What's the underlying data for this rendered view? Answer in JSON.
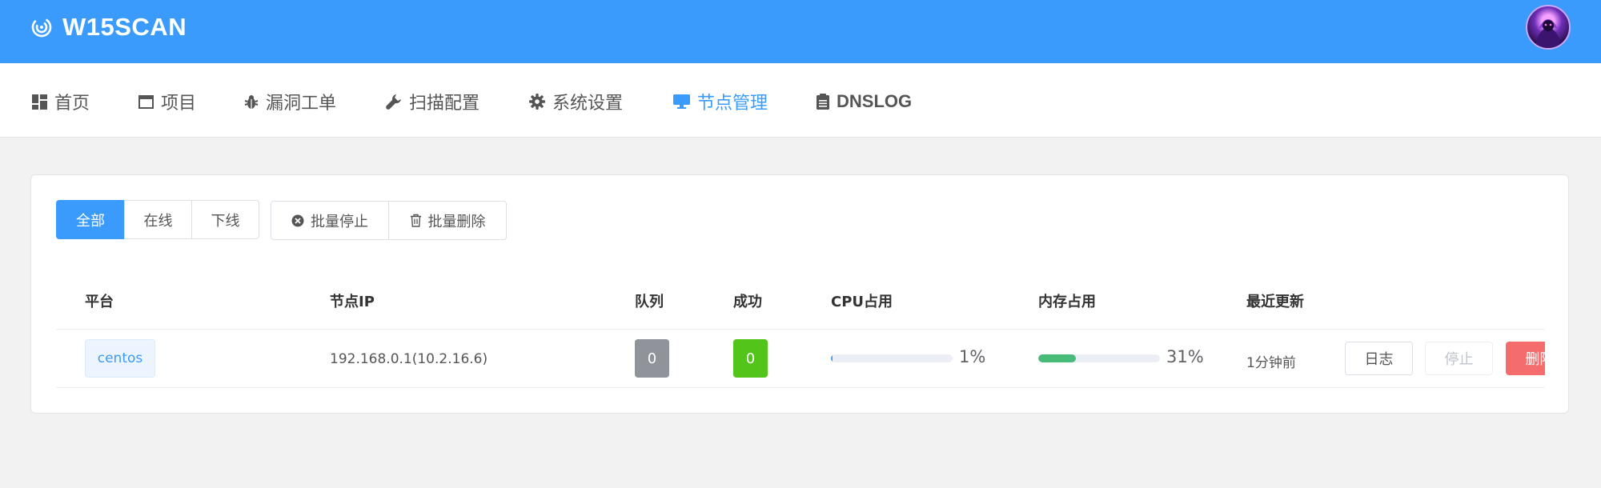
{
  "app": {
    "title": "W15SCAN"
  },
  "nav": [
    {
      "label": "首页",
      "icon": "dashboard-icon",
      "active": false
    },
    {
      "label": "项目",
      "icon": "window-icon",
      "active": false
    },
    {
      "label": "漏洞工单",
      "icon": "bug-icon",
      "active": false
    },
    {
      "label": "扫描配置",
      "icon": "wrench-icon",
      "active": false
    },
    {
      "label": "系统设置",
      "icon": "gear-icon",
      "active": false
    },
    {
      "label": "节点管理",
      "icon": "monitor-icon",
      "active": true
    },
    {
      "label": "DNSLOG",
      "icon": "clipboard-icon",
      "active": false
    }
  ],
  "filter_tabs": {
    "all": "全部",
    "online": "在线",
    "offline": "下线",
    "selected": "全部"
  },
  "actions": {
    "batch_stop": "批量停止",
    "batch_delete": "批量删除"
  },
  "table": {
    "headers": {
      "platform": "平台",
      "ip": "节点IP",
      "queue": "队列",
      "success": "成功",
      "cpu": "CPU占用",
      "mem": "内存占用",
      "updated": "最近更新"
    },
    "rows": [
      {
        "platform": "centos",
        "ip": "192.168.0.1(10.2.16.6)",
        "queue": "0",
        "success": "0",
        "cpu_label": "1%",
        "cpu_value": 1,
        "mem_label": "31%",
        "mem_value": 31,
        "updated": "1分钟前",
        "ops": {
          "log": "日志",
          "stop": "停止",
          "delete": "删除"
        }
      }
    ]
  },
  "colors": {
    "primary": "#3a9bfd",
    "queue_badge": "#909399",
    "success_badge": "#52c41a",
    "mem_bar": "#48bb78",
    "cpu_bar": "#3a9bfd",
    "danger": "#f56c6c"
  }
}
